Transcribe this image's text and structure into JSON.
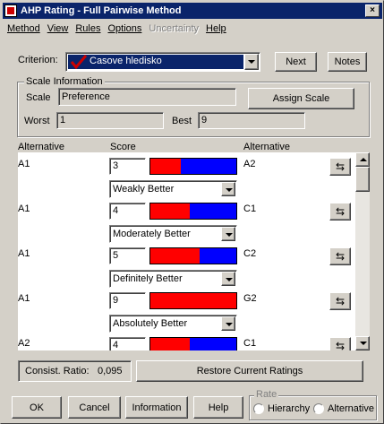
{
  "window": {
    "title": "AHP Rating - Full Pairwise Method",
    "close_label": "×"
  },
  "menu": [
    "Method",
    "View",
    "Rules",
    "Options",
    "Uncertainty",
    "Help"
  ],
  "criterion": {
    "label": "Criterion:",
    "value": "Casove hledisko"
  },
  "buttons": {
    "next": "Next",
    "notes": "Notes",
    "assign_scale": "Assign Scale",
    "restore": "Restore Current Ratings",
    "ok": "OK",
    "cancel": "Cancel",
    "information": "Information",
    "help": "Help"
  },
  "scale_info": {
    "group_label": "Scale Information",
    "scale_label": "Scale",
    "scale_value": "Preference",
    "worst_label": "Worst",
    "worst_value": "1",
    "best_label": "Best",
    "best_value": "9"
  },
  "columns": {
    "alternative_left": "Alternative",
    "score": "Score",
    "alternative_right": "Alternative"
  },
  "rows": [
    {
      "left": "A1",
      "score": "3",
      "red_fraction": 0.35,
      "right": "A2",
      "rating": "Weakly Better"
    },
    {
      "left": "A1",
      "score": "4",
      "red_fraction": 0.46,
      "right": "C1",
      "rating": "Moderately Better"
    },
    {
      "left": "A1",
      "score": "5",
      "red_fraction": 0.57,
      "right": "C2",
      "rating": "Definitely Better"
    },
    {
      "left": "A1",
      "score": "9",
      "red_fraction": 1.0,
      "right": "G2",
      "rating": "Absolutely Better"
    },
    {
      "left": "A2",
      "score": "4",
      "red_fraction": 0.46,
      "right": "C1",
      "rating": ""
    }
  ],
  "consistency": {
    "label": "Consist. Ratio:",
    "value": "0,095"
  },
  "rate_group": {
    "label": "Rate",
    "options": [
      "Hierarchy",
      "Alternative"
    ]
  },
  "colors": {
    "title_bg": "#0a246a",
    "bar_red": "#ff0000",
    "bar_blue": "#0000ff",
    "checkmark": "#cc0000"
  }
}
